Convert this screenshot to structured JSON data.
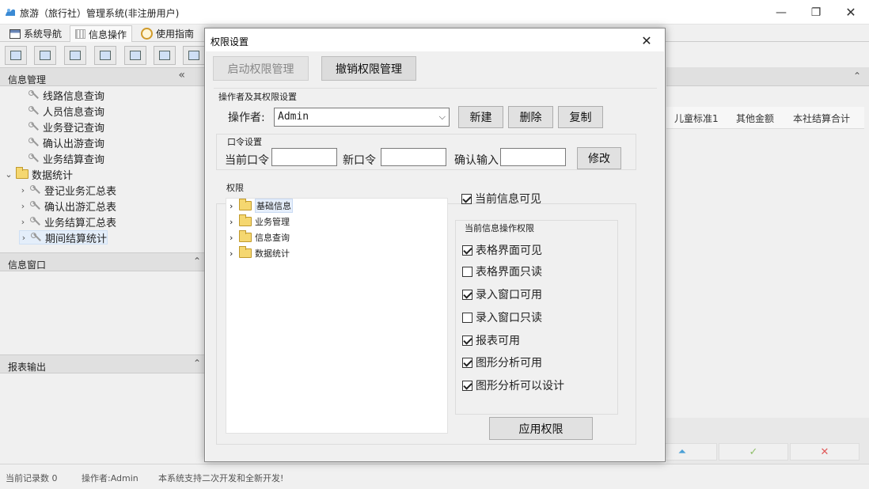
{
  "window": {
    "title": "旅游（旅行社）管理系统(非注册用户)",
    "minimize_glyph": "—",
    "maximize_glyph": "❐",
    "close_glyph": "✕"
  },
  "menu_tabs": [
    {
      "label": "系统导航",
      "icon": "window-icon"
    },
    {
      "label": "信息操作",
      "icon": "grid-icon"
    },
    {
      "label": "使用指南",
      "icon": "help-circle-icon"
    }
  ],
  "left_panels": {
    "info_management": "信息管理",
    "info_window": "信息窗口",
    "report_output": "报表输出",
    "collapse_glyph_left": "«",
    "collapse_glyph_up": "⌃"
  },
  "left_tree": {
    "query_items": [
      "线路信息查询",
      "人员信息查询",
      "业务登记查询",
      "确认出游查询",
      "业务结算查询"
    ],
    "stats_folder": "数据统计",
    "stats_items": [
      "登记业务汇总表",
      "确认出游汇总表",
      "业务结算汇总表",
      "期间结算统计"
    ]
  },
  "right_grid": {
    "columns": [
      "儿童标准1",
      "其他金额",
      "本社结算合计"
    ],
    "nav_symbols": [
      "⏶",
      "✓",
      "✕"
    ]
  },
  "status_bar": {
    "record_count": "当前记录数 0",
    "operator": "操作者:Admin",
    "message": "本系统支持二次开发和全新开发!"
  },
  "dialog": {
    "title": "权限设置",
    "close_glyph": "✕",
    "enable_button": "启动权限管理",
    "cancel_button": "撤销权限管理",
    "operator_section": "操作者及其权限设置",
    "operator_label": "操作者:",
    "operator_value": "Admin",
    "dropdown_glyph": "⌵",
    "new_button": "新建",
    "delete_button": "删除",
    "copy_button": "复制",
    "password_section": "口令设置",
    "current_password_label": "当前口令",
    "new_password_label": "新口令",
    "confirm_password_label": "确认输入",
    "modify_button": "修改",
    "permission_section": "权限",
    "permission_tree": [
      "基础信息",
      "业务管理",
      "信息查询",
      "数据统计"
    ],
    "tree_chevron": "›",
    "current_info_visible": {
      "label": "当前信息可见",
      "checked": true
    },
    "ops_section": "当前信息操作权限",
    "options": [
      {
        "label": "表格界面可见",
        "checked": true
      },
      {
        "label": "表格界面只读",
        "checked": false
      },
      {
        "label": "录入窗口可用",
        "checked": true
      },
      {
        "label": "录入窗口只读",
        "checked": false
      },
      {
        "label": "报表可用",
        "checked": true
      },
      {
        "label": "图形分析可用",
        "checked": true
      },
      {
        "label": "图形分析可以设计",
        "checked": true
      }
    ],
    "apply_button": "应用权限"
  }
}
